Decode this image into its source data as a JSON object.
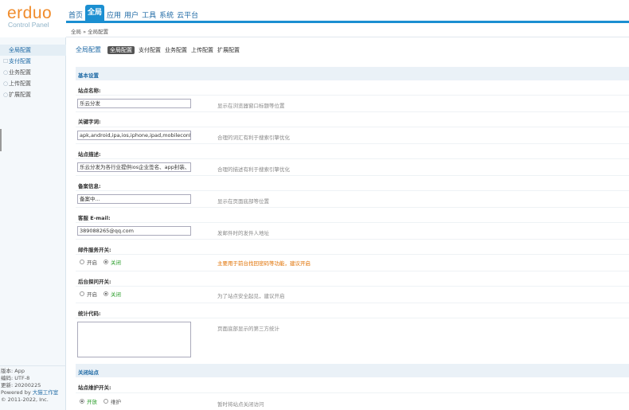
{
  "brand": {
    "logo": "erduo",
    "subtitle": "Control Panel"
  },
  "topnav": [
    "首页",
    "全局",
    "应用",
    "用户",
    "工具",
    "系统",
    "云平台"
  ],
  "breadcrumb": "全局 » 全局配置",
  "sidebar": {
    "items": [
      "全局配置",
      "支付配置",
      "业务配置",
      "上传配置",
      "扩展配置"
    ],
    "footer": {
      "version": "版本: App",
      "encoding": "编码: UTF-8",
      "update": "更新: 20200225",
      "powered_prefix": "Powered by",
      "powered_by": "大猫工作室",
      "copyright": "© 2011-2022, Inc."
    }
  },
  "main": {
    "title": "全局配置",
    "tabs": [
      "全局配置",
      "支付配置",
      "业务配置",
      "上传配置",
      "扩展配置"
    ],
    "section_basic": "基本设置",
    "section_close": "关闭站点",
    "site_name": {
      "label": "站点名称:",
      "value": "乐云分发",
      "hint": "显示在浏览器窗口标题等位置"
    },
    "keywords": {
      "label": "关键字词:",
      "value": "apk,android,ipa,ios,iphone,ipad,mobileconf",
      "hint": "合理的词汇有利于搜索引擎优化"
    },
    "description": {
      "label": "站点描述:",
      "value": "乐云分发为各行业提供ios企业签名、app封装、",
      "hint": "合理的描述有利于搜索引擎优化"
    },
    "icp": {
      "label": "备案信息:",
      "value": "备案中...",
      "hint": "显示在页面底部等位置"
    },
    "email": {
      "label": "客服 E-mail:",
      "value": "389088265@qq.com",
      "hint": "发邮件时的发件人地址"
    },
    "mail_service": {
      "label": "邮件服务开关:",
      "opt_on": "开启",
      "opt_off": "关闭",
      "hint": "主要用于前台找回密码等功能，建议开启"
    },
    "admin_log": {
      "label": "后台探问开关:",
      "opt_on": "开启",
      "opt_off": "关闭",
      "hint": "为了站点安全起见，建议开启"
    },
    "stats": {
      "label": "统计代码:",
      "hint": "页面底部显示的第三方统计"
    },
    "maintenance": {
      "label": "站点维护开关:",
      "opt_on": "开放",
      "opt_off": "维护",
      "hint": "暂时将站点关闭访问"
    }
  }
}
